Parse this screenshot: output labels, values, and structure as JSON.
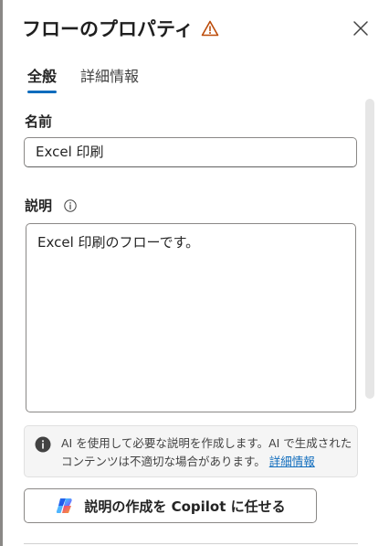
{
  "panel": {
    "title": "フローのプロパティ",
    "tabs": [
      {
        "label": "全般",
        "active": true
      },
      {
        "label": "詳細情報",
        "active": false
      }
    ]
  },
  "form": {
    "name_label": "名前",
    "name_value": "Excel 印刷",
    "description_label": "説明",
    "description_value": "Excel 印刷のフローです。"
  },
  "notice": {
    "text": "AI を使用して必要な説明を作成します。AI で生成されたコンテンツは不適切な場合があります。",
    "link": "詳細情報"
  },
  "copilot_button": {
    "label": "説明の作成を Copilot に任せる"
  },
  "colors": {
    "accent": "#0f6cbd",
    "warning": "#bc4b09"
  }
}
